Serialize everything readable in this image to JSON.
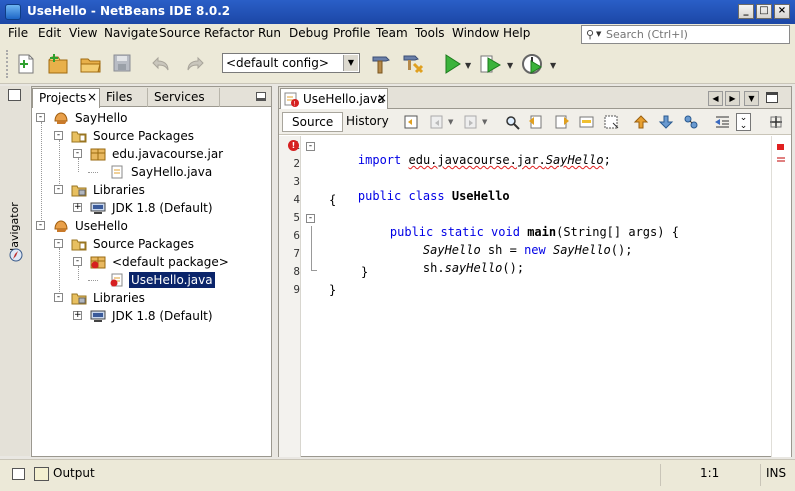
{
  "window": {
    "title": "UseHello - NetBeans IDE 8.0.2"
  },
  "menu": [
    "File",
    "Edit",
    "View",
    "Navigate",
    "Source",
    "Refactor",
    "Run",
    "Debug",
    "Profile",
    "Team",
    "Tools",
    "Window",
    "Help"
  ],
  "search": {
    "placeholder": "Search (Ctrl+I)"
  },
  "toolbar": {
    "config_value": "<default config>"
  },
  "navigator": {
    "label": "Navigator"
  },
  "projects_panel": {
    "tabs": [
      "Projects",
      "Files",
      "Services"
    ],
    "tree": [
      {
        "label": "SayHello",
        "icon": "project-icon",
        "level": 0,
        "expander": "-"
      },
      {
        "label": "Source Packages",
        "icon": "folder-icon",
        "level": 1,
        "expander": "-"
      },
      {
        "label": "edu.javacourse.jar",
        "icon": "package-icon",
        "level": 2,
        "expander": "-"
      },
      {
        "label": "SayHello.java",
        "icon": "java-file-icon",
        "level": 3,
        "expander": ""
      },
      {
        "label": "Libraries",
        "icon": "libraries-folder-icon",
        "level": 1,
        "expander": "-"
      },
      {
        "label": "JDK 1.8 (Default)",
        "icon": "jdk-icon",
        "level": 2,
        "expander": "+"
      },
      {
        "label": "UseHello",
        "icon": "project-icon",
        "level": 0,
        "expander": "-"
      },
      {
        "label": "Source Packages",
        "icon": "folder-icon",
        "level": 1,
        "expander": "-"
      },
      {
        "label": "<default package>",
        "icon": "package-error-icon",
        "level": 2,
        "expander": "-"
      },
      {
        "label": "UseHello.java",
        "icon": "java-file-error-icon",
        "level": 3,
        "expander": "",
        "selected": true
      },
      {
        "label": "Libraries",
        "icon": "libraries-folder-icon",
        "level": 1,
        "expander": "-"
      },
      {
        "label": "JDK 1.8 (Default)",
        "icon": "jdk-icon",
        "level": 2,
        "expander": "+"
      }
    ]
  },
  "editor": {
    "tab": "UseHello.java",
    "subtabs": [
      "Source",
      "History"
    ],
    "lines": [
      {
        "num": "1",
        "fold": "-",
        "error": true
      },
      {
        "num": "2"
      },
      {
        "num": "3"
      },
      {
        "num": "4"
      },
      {
        "num": "5",
        "fold": "-"
      },
      {
        "num": "6"
      },
      {
        "num": "7"
      },
      {
        "num": "8"
      },
      {
        "num": "9"
      }
    ],
    "code": {
      "l1_kw": "import",
      "l1_pkg": "edu.javacourse.jar.",
      "l1_cls": "SayHello",
      "l1_end": ";",
      "l3_kw": "public class",
      "l3_name": "UseHello",
      "l4": "{",
      "l5_kw": "public static void",
      "l5_name": "main",
      "l5_args": "(String[] args) {",
      "l6_type": "SayHello",
      "l6_mid": " sh = ",
      "l6_new": "new",
      "l6_ctor": "SayHello",
      "l6_end": "();",
      "l7_obj": "sh.",
      "l7_method": "sayHello",
      "l7_end": "();",
      "l8": "}",
      "l9": "}"
    }
  },
  "status": {
    "output": "Output",
    "position": "1:1",
    "mode": "INS"
  },
  "colors": {
    "keyword": "#0000e6",
    "selection": "#0a246a",
    "error": "#e02020",
    "titlebar": "#1c47a6"
  }
}
